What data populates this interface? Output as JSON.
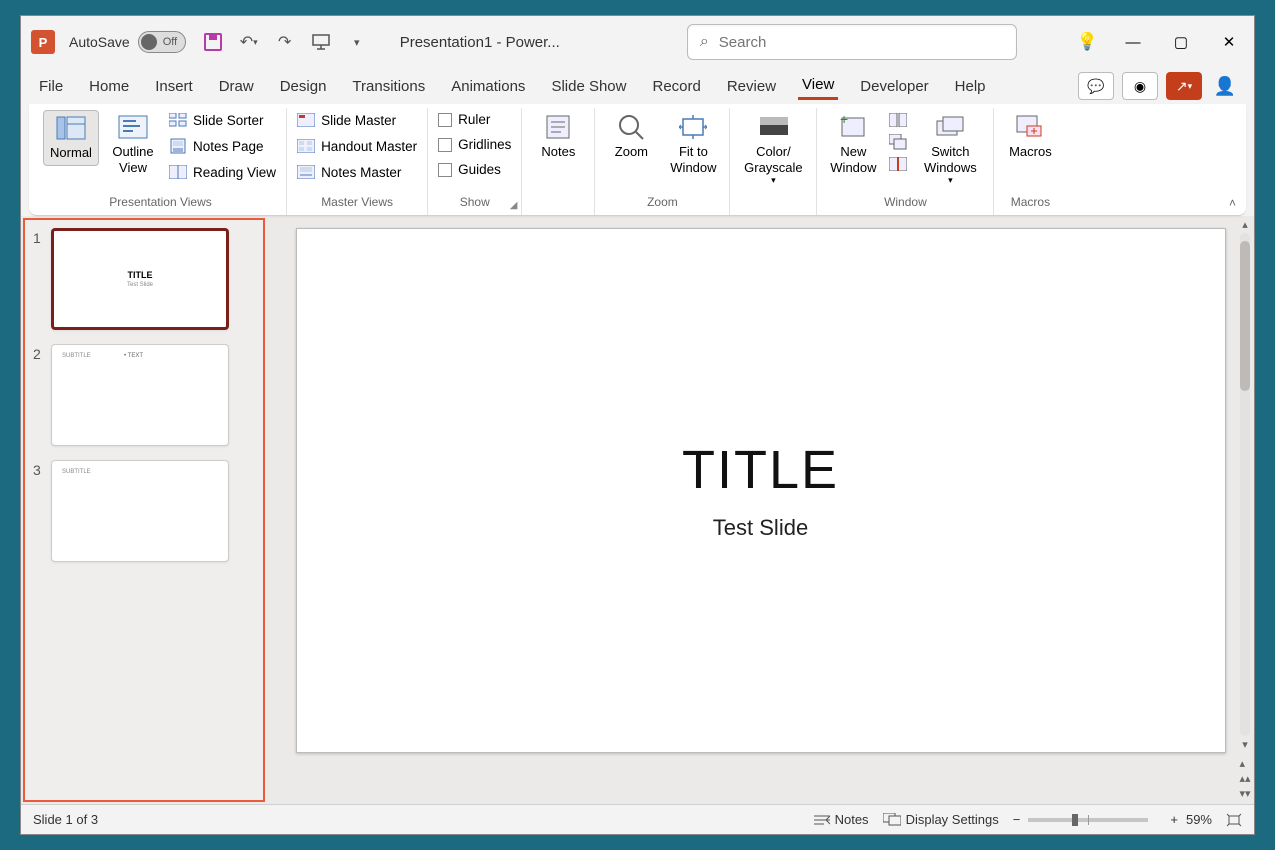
{
  "titlebar": {
    "autosave_label": "AutoSave",
    "autosave_state": "Off",
    "document_title": "Presentation1 - Power...",
    "search_placeholder": "Search"
  },
  "tabs": {
    "items": [
      "File",
      "Home",
      "Insert",
      "Draw",
      "Design",
      "Transitions",
      "Animations",
      "Slide Show",
      "Record",
      "Review",
      "View",
      "Developer",
      "Help"
    ],
    "active": "View"
  },
  "ribbon": {
    "presentation_views": {
      "label": "Presentation Views",
      "normal": "Normal",
      "outline": "Outline View",
      "slide_sorter": "Slide Sorter",
      "notes_page": "Notes Page",
      "reading_view": "Reading View"
    },
    "master_views": {
      "label": "Master Views",
      "slide_master": "Slide Master",
      "handout_master": "Handout Master",
      "notes_master": "Notes Master"
    },
    "show": {
      "label": "Show",
      "ruler": "Ruler",
      "gridlines": "Gridlines",
      "guides": "Guides"
    },
    "notes_btn": "Notes",
    "zoom": {
      "label": "Zoom",
      "zoom": "Zoom",
      "fit": "Fit to Window"
    },
    "color": {
      "btn": "Color/ Grayscale"
    },
    "window": {
      "label": "Window",
      "new": "New Window",
      "switch": "Switch Windows"
    },
    "macros": {
      "label": "Macros",
      "btn": "Macros"
    }
  },
  "slides": {
    "current_title": "TITLE",
    "current_subtitle": "Test Slide",
    "thumbs": [
      {
        "num": "1",
        "title": "TITLE",
        "sub": "Test Slide",
        "selected": true
      },
      {
        "num": "2",
        "corner": "SUBTITLE",
        "body": "• TEXT"
      },
      {
        "num": "3",
        "corner": "SUBTITLE"
      }
    ]
  },
  "statusbar": {
    "slide_info": "Slide 1 of 3",
    "notes": "Notes",
    "display_settings": "Display Settings",
    "zoom_pct": "59%"
  }
}
